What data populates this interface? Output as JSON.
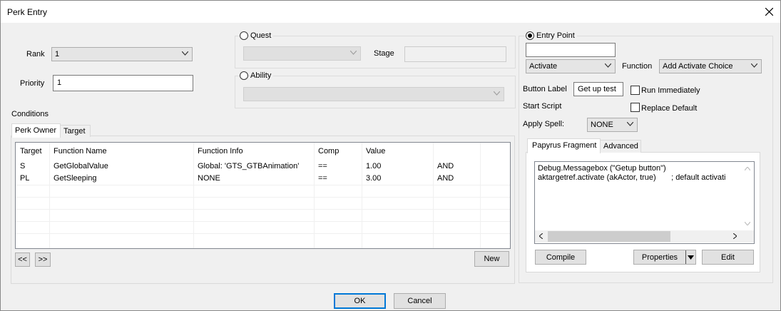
{
  "window": {
    "title": "Perk Entry"
  },
  "rank": {
    "label": "Rank",
    "value": "1"
  },
  "priority": {
    "label": "Priority",
    "value": "1"
  },
  "quest": {
    "label": "Quest",
    "stage_label": "Stage",
    "value": "",
    "stage_value": ""
  },
  "ability": {
    "label": "Ability",
    "value": ""
  },
  "conditions": {
    "label": "Conditions",
    "tabs": [
      "Perk Owner",
      "Target"
    ],
    "columns": [
      "Target",
      "Function Name",
      "Function Info",
      "Comp",
      "Value",
      ""
    ],
    "rows": [
      {
        "target": "S",
        "function": "GetGlobalValue",
        "info": "Global: 'GTS_GTBAnimation'",
        "comp": "==",
        "value": "1.00",
        "op": "AND"
      },
      {
        "target": "PL",
        "function": "GetSleeping",
        "info": "NONE",
        "comp": "==",
        "value": "3.00",
        "op": "AND"
      }
    ],
    "prev_label": "<<",
    "next_label": ">>",
    "new_label": "New"
  },
  "entry_point": {
    "label": "Entry Point",
    "search_value": "",
    "type_value": "Activate",
    "function_label": "Function",
    "function_value": "Add Activate Choice",
    "button_label_label": "Button Label",
    "button_label_value": "Get up test",
    "run_immediately_label": "Run Immediately",
    "start_script_label": "Start Script",
    "replace_default_label": "Replace Default",
    "apply_spell_label": "Apply Spell:",
    "apply_spell_value": "NONE"
  },
  "fragment": {
    "tabs": [
      "Papyrus Fragment",
      "Advanced"
    ],
    "code_lines": [
      "Debug.Messagebox (\"Getup button\")",
      "aktargetref.activate (akActor, true)       ; default activati"
    ],
    "compile_label": "Compile",
    "properties_label": "Properties",
    "edit_label": "Edit"
  },
  "footer": {
    "ok_label": "OK",
    "cancel_label": "Cancel"
  }
}
